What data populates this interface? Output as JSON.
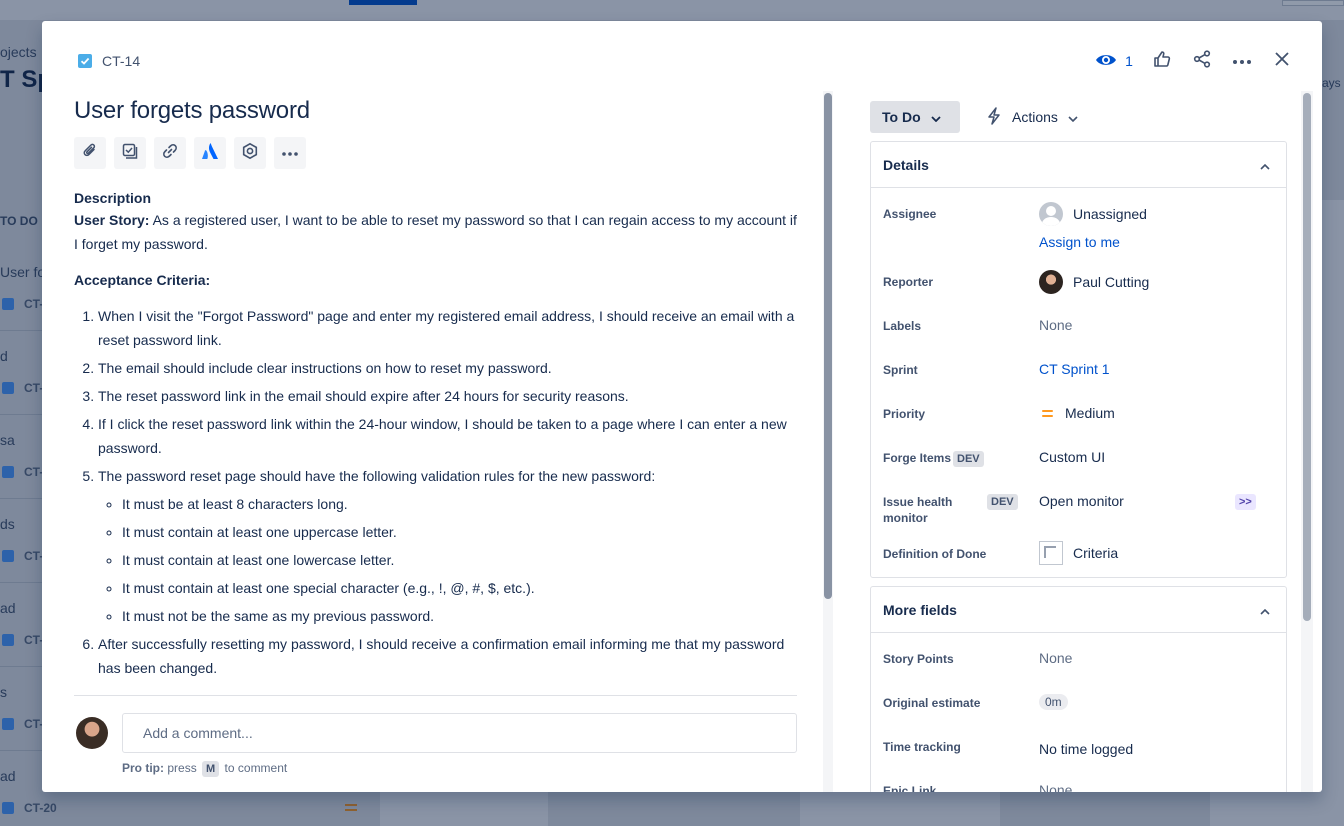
{
  "background": {
    "breadcrumb_fragment": "ojects",
    "board_title_fragment": "T Sp",
    "column_header_fragment": "TO DO",
    "days_fragment": "ays",
    "cards": [
      {
        "title": "User fo",
        "key": "CT-"
      },
      {
        "title": "d",
        "key": "CT-"
      },
      {
        "title": "sa",
        "key": "CT-"
      },
      {
        "title": "ds",
        "key": "CT-"
      },
      {
        "title": "ad",
        "key": "CT-"
      },
      {
        "title": "s",
        "key": "CT-"
      },
      {
        "title": "ad",
        "key": "CT-20"
      }
    ]
  },
  "issue": {
    "key": "CT-14",
    "watch_count": "1",
    "summary": "User forgets password",
    "description_label": "Description",
    "user_story_label": "User Story:",
    "user_story_text": " As a registered user, I want to be able to reset my password so that I can regain access to my account if I forget my password.",
    "acceptance_label": "Acceptance Criteria:",
    "criteria": [
      "When I visit the \"Forgot Password\" page and enter my registered email address, I should receive an email with a reset password link.",
      "The email should include clear instructions on how to reset my password.",
      "The reset password link in the email should expire after 24 hours for security reasons.",
      "If I click the reset password link within the 24-hour window, I should be taken to a page where I can enter a new password.",
      "The password reset page should have the following validation rules for the new password:",
      "After successfully resetting my password, I should receive a confirmation email informing me that my password has been changed."
    ],
    "validation_rules": [
      "It must be at least 8 characters long.",
      "It must contain at least one uppercase letter.",
      "It must contain at least one lowercase letter.",
      "It must contain at least one special character (e.g., !, @, #, $, etc.).",
      "It must not be the same as my previous password."
    ]
  },
  "toolbar_icons": [
    "paperclip-icon",
    "child-issue-icon",
    "link-icon",
    "atlassian-icon",
    "hexagon-app-icon",
    "more-icon"
  ],
  "comment": {
    "placeholder": "Add a comment...",
    "protip_prefix": "Pro tip:",
    "protip_press": "press",
    "protip_key": "M",
    "protip_suffix": "to comment"
  },
  "status": {
    "label": "To Do",
    "actions_label": "Actions"
  },
  "details": {
    "title": "Details",
    "assignee_label": "Assignee",
    "assignee_value": "Unassigned",
    "assign_to_me": "Assign to me",
    "reporter_label": "Reporter",
    "reporter_value": "Paul Cutting",
    "labels_label": "Labels",
    "labels_value": "None",
    "sprint_label": "Sprint",
    "sprint_value": "CT Sprint 1",
    "priority_label": "Priority",
    "priority_value": "Medium",
    "forge_label": "Forge Items",
    "forge_value": "Custom UI",
    "health_label_1": "Issue health",
    "health_label_2": "monitor",
    "health_value": "Open monitor",
    "health_badge": ">>",
    "dev_badge": "DEV",
    "dod_label": "Definition of Done",
    "dod_value": "Criteria"
  },
  "more_fields": {
    "title": "More fields",
    "story_points_label": "Story Points",
    "story_points_value": "None",
    "estimate_label": "Original estimate",
    "estimate_value": "0m",
    "tracking_label": "Time tracking",
    "tracking_value": "No time logged",
    "epic_label": "Epic Link",
    "epic_value": "None"
  },
  "colors": {
    "accent": "#0052cc",
    "story": "#4bade8",
    "priority_medium": "#ff991f",
    "overlay": "rgba(9,30,66,0.45)"
  }
}
